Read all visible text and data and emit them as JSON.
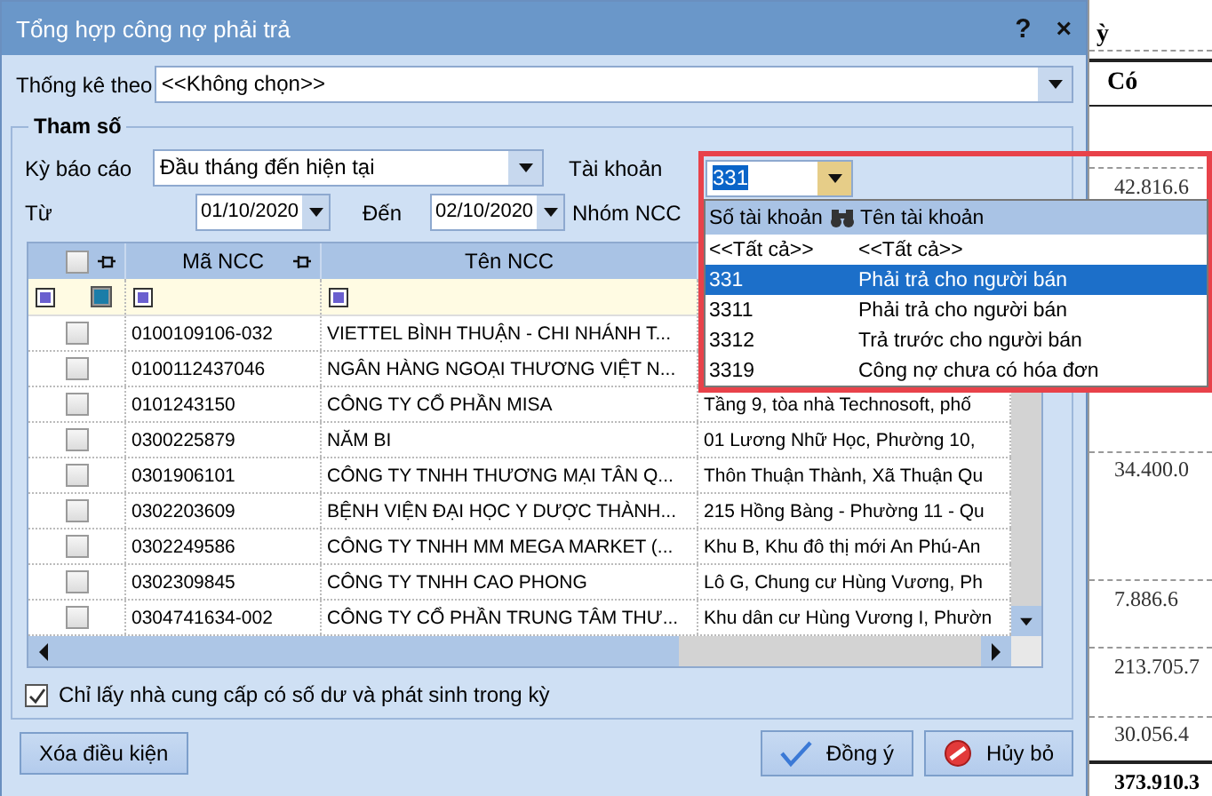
{
  "window": {
    "title": "Tổng hợp công nợ phải trả",
    "help": "?",
    "close": "×"
  },
  "group_by": {
    "label": "Thống kê theo",
    "value": "<<Không chọn>>"
  },
  "parameters": {
    "title": "Tham số",
    "period": {
      "label": "Kỳ báo cáo",
      "value": "Đầu tháng đến hiện tại"
    },
    "account": {
      "label": "Tài khoản",
      "value": "331"
    },
    "from": {
      "label": "Từ",
      "value": "01/10/2020"
    },
    "to": {
      "label": "Đến",
      "value": "02/10/2020"
    },
    "supplier_group": {
      "label": "Nhóm NCC"
    },
    "grid": {
      "columns": [
        "Mã NCC",
        "Tên NCC"
      ],
      "header_checked": false,
      "rows": [
        {
          "checked": false,
          "code": "0100109106-032",
          "name": "VIETTEL BÌNH THUẬN - CHI NHÁNH T...",
          "address": ""
        },
        {
          "checked": false,
          "code": "0100112437046",
          "name": "NGÂN HÀNG NGOẠI THƯƠNG VIỆT N...",
          "address": ""
        },
        {
          "checked": false,
          "code": "0101243150",
          "name": "CÔNG TY CỔ PHẦN MISA",
          "address": "Tầng 9, tòa nhà Technosoft, phố"
        },
        {
          "checked": false,
          "code": "0300225879",
          "name": "NĂM BI",
          "address": "01 Lương Nhữ Học, Phường 10,"
        },
        {
          "checked": false,
          "code": "0301906101",
          "name": "CÔNG TY TNHH THƯƠNG MẠI TÂN Q...",
          "address": "Thôn Thuận Thành, Xã Thuận Qu"
        },
        {
          "checked": false,
          "code": "0302203609",
          "name": "BỆNH VIỆN ĐẠI HỌC Y DƯỢC THÀNH...",
          "address": "215 Hồng Bàng - Phường 11 - Qu"
        },
        {
          "checked": false,
          "code": "0302249586",
          "name": "CÔNG TY TNHH MM MEGA MARKET (...",
          "address": "Khu B, Khu đô thị mới An Phú-An"
        },
        {
          "checked": false,
          "code": "0302309845",
          "name": "CÔNG TY TNHH CAO PHONG",
          "address": "Lô G, Chung cư Hùng Vương, Ph"
        },
        {
          "checked": false,
          "code": "0304741634-002",
          "name": "CÔNG TY CỔ PHẦN TRUNG TÂM THƯ...",
          "address": "Khu dân cư Hùng Vương I, Phườn"
        }
      ]
    },
    "only_with_balance": {
      "label": "Chỉ lấy nhà cung cấp có số dư và phát sinh trong kỳ",
      "checked": true
    }
  },
  "account_dropdown": {
    "columns": [
      "Số tài khoản",
      "Tên tài khoản"
    ],
    "rows": [
      {
        "number": "<<Tất cả>>",
        "name": "<<Tất cả>>",
        "selected": false
      },
      {
        "number": "331",
        "name": "Phải trả cho người bán",
        "selected": true
      },
      {
        "number": "3311",
        "name": "Phải trả cho người bán",
        "selected": false
      },
      {
        "number": "3312",
        "name": "Trả trước cho người bán",
        "selected": false
      },
      {
        "number": "3319",
        "name": "Công nợ chưa có hóa đơn",
        "selected": false
      }
    ]
  },
  "buttons": [
    {
      "kind": "clear",
      "label": "Xóa điều kiện"
    },
    {
      "kind": "ok",
      "label": "Đồng ý"
    },
    {
      "kind": "cancel",
      "label": "Hủy bỏ"
    }
  ],
  "background_report": {
    "header_fragment": "ỳ",
    "column": "Có",
    "values": [
      "42.816.6",
      "34.400.0",
      "7.886.6",
      "213.705.7",
      "30.056.4",
      "373.910.3"
    ]
  }
}
